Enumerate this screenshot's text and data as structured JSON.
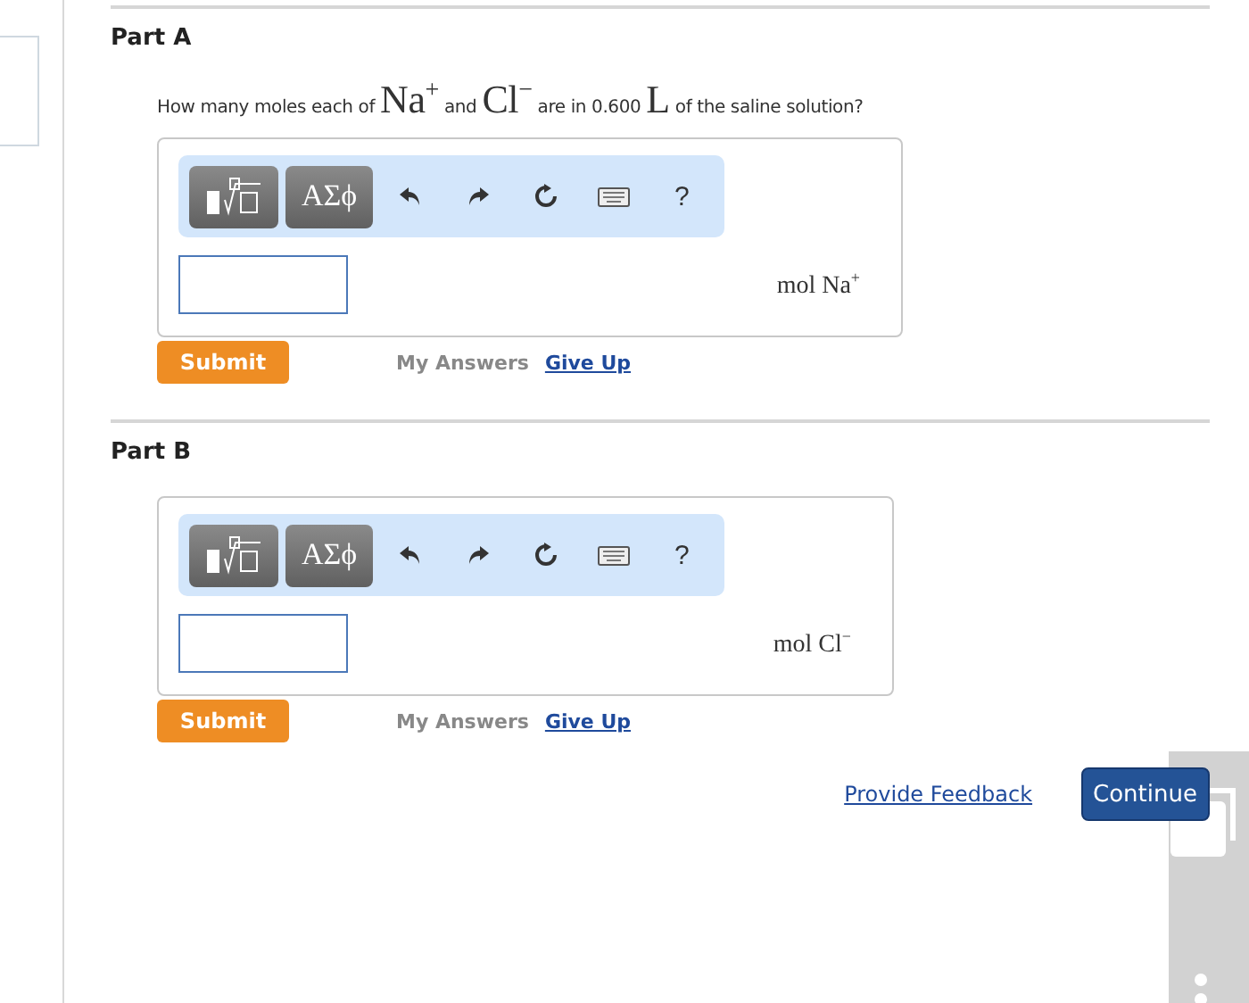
{
  "parts": [
    {
      "label": "Part A",
      "question": [
        {
          "kind": "text",
          "text": "How many moles each of"
        },
        {
          "kind": "math",
          "text": "Na$^{+}$"
        },
        {
          "kind": "text",
          "text": "and"
        },
        {
          "kind": "math",
          "text": "Cl$^{−}$"
        },
        {
          "kind": "text",
          "text": "are in 0.600"
        },
        {
          "kind": "math",
          "text": "L"
        },
        {
          "kind": "text",
          "text": "of the saline solution?"
        }
      ],
      "greek": "ΑΣϕ",
      "help": "?",
      "unit": "mol Na$^{+}$",
      "submit": "Submit",
      "my_answers": "My Answers",
      "give_up": "Give Up"
    },
    {
      "label": "Part B",
      "greek": "ΑΣϕ",
      "help": "?",
      "unit": "mol Cl$^{−}$",
      "submit": "Submit",
      "my_answers": "My Answers",
      "give_up": "Give Up"
    }
  ],
  "feedback_link": "Provide Feedback",
  "continue_button": "Continue"
}
